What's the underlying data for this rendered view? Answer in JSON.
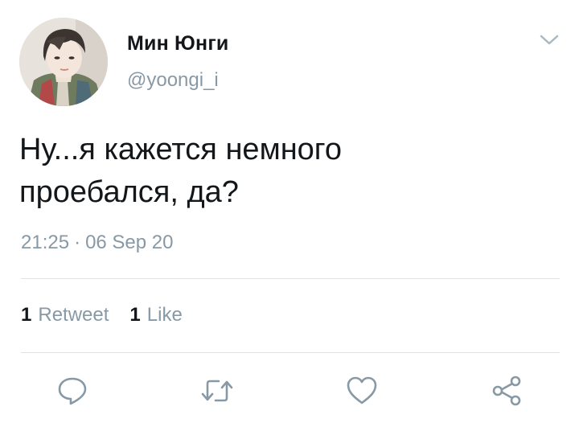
{
  "user": {
    "display_name": "Мин Юнги",
    "handle": "@yoongi_i",
    "avatar_icon": "profile-photo"
  },
  "tweet": {
    "text_line1": "Ну...я кажется немного",
    "text_line2": "проебался, да?",
    "time": "21:25",
    "separator": "·",
    "date": "06 Sep 20"
  },
  "stats": {
    "retweets_count": "1",
    "retweets_label": "Retweet",
    "likes_count": "1",
    "likes_label": "Like"
  },
  "actions": {
    "reply_icon": "reply-icon",
    "retweet_icon": "retweet-icon",
    "like_icon": "heart-icon",
    "share_icon": "share-icon"
  },
  "colors": {
    "text": "#14171a",
    "secondary": "#8899a6",
    "divider": "#dfe3e6"
  }
}
